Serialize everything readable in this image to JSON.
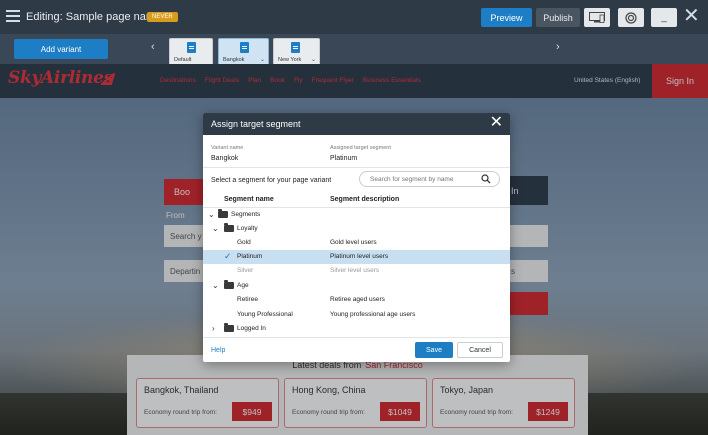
{
  "editor": {
    "title": "Editing: Sample page name",
    "status_badge": "NEVER",
    "preview_label": "Preview",
    "publish_label": "Publish",
    "minimize_label": "_"
  },
  "variants": {
    "add_label": "Add variant",
    "items": [
      {
        "label": "Default",
        "has_dropdown": false,
        "selected": false
      },
      {
        "label": "Bangkok",
        "has_dropdown": true,
        "selected": true
      },
      {
        "label": "New York",
        "has_dropdown": true,
        "selected": false
      }
    ]
  },
  "site": {
    "logo": "SkyAirlines",
    "nav": [
      "Destinations",
      "Flight Deals",
      "Plan",
      "Book",
      "Fly",
      "Frequent Flyer",
      "Business Essentials"
    ],
    "region": "United States (English)",
    "signin": "Sign In",
    "booking": {
      "tab_left": "Boo",
      "tab_right": "In",
      "from_label": "From",
      "search_placeholder": "Search y",
      "depart_placeholder": "Departin",
      "right_input_fragment": "s"
    },
    "deals": {
      "title_prefix": "Latest deals from",
      "title_city": "San Francisco",
      "cards": [
        {
          "destination": "Bangkok, Thailand",
          "label": "Economy round trip from:",
          "price": "$949"
        },
        {
          "destination": "Hong Kong, China",
          "label": "Economy round trip from:",
          "price": "$1049"
        },
        {
          "destination": "Tokyo, Japan",
          "label": "Economy round trip from:",
          "price": "$1249"
        }
      ]
    }
  },
  "modal": {
    "title": "Assign target segment",
    "variant_name_label": "Variant name",
    "variant_name": "Bangkok",
    "assigned_segment_label": "Assigned target segment",
    "assigned_segment": "Platinum",
    "select_prompt": "Select a segment for your page variant",
    "search_placeholder": "Search for segment by name",
    "col_name": "Segment name",
    "col_desc": "Segment description",
    "tree": [
      {
        "name": "Segments",
        "desc": "",
        "level": 0,
        "folder": true,
        "expanded": true
      },
      {
        "name": "Loyalty",
        "desc": "",
        "level": 1,
        "folder": true,
        "expanded": true
      },
      {
        "name": "Gold",
        "desc": "Gold level users",
        "level": 2,
        "folder": false
      },
      {
        "name": "Platinum",
        "desc": "Platinum level users",
        "level": 2,
        "folder": false,
        "selected": true
      },
      {
        "name": "Silver",
        "desc": "Silver level users",
        "level": 2,
        "folder": false,
        "muted": true
      },
      {
        "name": "Age",
        "desc": "",
        "level": 1,
        "folder": true,
        "expanded": true
      },
      {
        "name": "Retiree",
        "desc": "Retiree aged users",
        "level": 2,
        "folder": false
      },
      {
        "name": "Young Professional",
        "desc": "Young professional age users",
        "level": 2,
        "folder": false
      },
      {
        "name": "Logged In",
        "desc": "",
        "level": 1,
        "folder": true,
        "expanded": false
      }
    ],
    "help": "Help",
    "save": "Save",
    "cancel": "Cancel"
  },
  "colors": {
    "brand_red": "#d6262e",
    "accent_blue": "#1d7ec5",
    "dark_bar": "#2f3a47",
    "selection": "#c7dff1"
  }
}
